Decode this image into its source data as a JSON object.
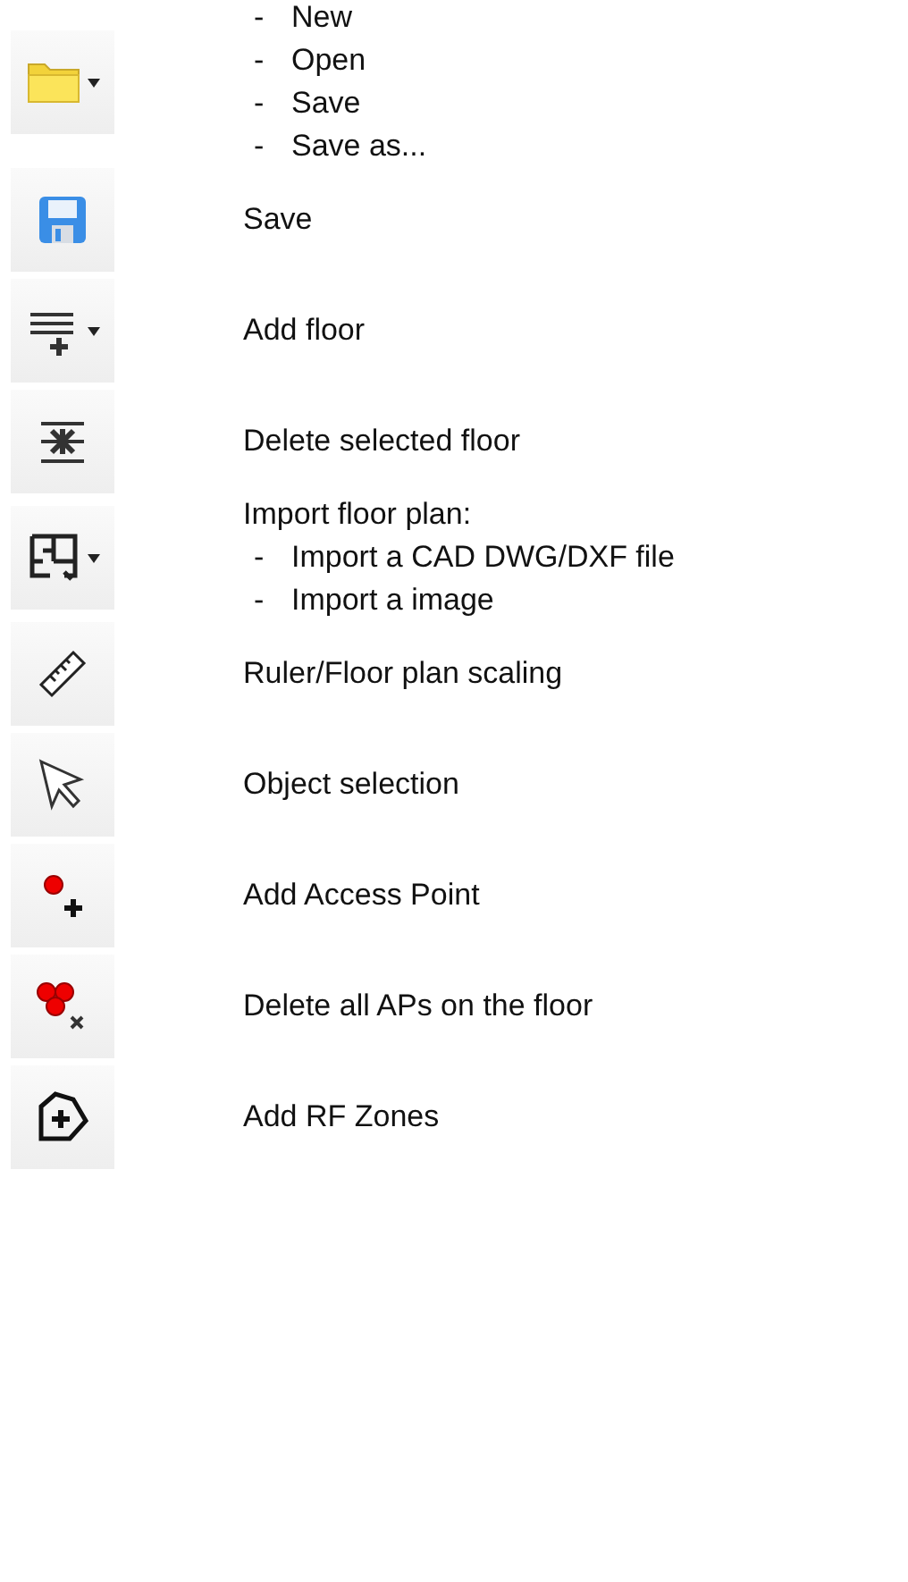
{
  "items": [
    {
      "kind": "folder",
      "dropdown": true,
      "lines": [
        {
          "bullet": "-",
          "text": "New"
        },
        {
          "bullet": "-",
          "text": "Open"
        },
        {
          "bullet": "-",
          "text": "Save"
        },
        {
          "bullet": "-",
          "text": "Save as..."
        }
      ]
    },
    {
      "kind": "floppy",
      "dropdown": false,
      "lines": [
        {
          "text": "Save"
        }
      ]
    },
    {
      "kind": "add-floor",
      "dropdown": true,
      "lines": [
        {
          "text": "Add floor"
        }
      ]
    },
    {
      "kind": "delete-floor",
      "dropdown": false,
      "lines": [
        {
          "text": "Delete selected floor"
        }
      ]
    },
    {
      "kind": "floor-plan",
      "dropdown": true,
      "lines": [
        {
          "text": "Import floor plan:"
        },
        {
          "bullet": "-",
          "text": "Import a CAD DWG/DXF file"
        },
        {
          "bullet": "-",
          "text": "Import a image"
        }
      ]
    },
    {
      "kind": "ruler",
      "dropdown": false,
      "lines": [
        {
          "text": "Ruler/Floor plan scaling"
        }
      ]
    },
    {
      "kind": "arrow",
      "dropdown": false,
      "lines": [
        {
          "text": "Object selection"
        }
      ]
    },
    {
      "kind": "add-point",
      "dropdown": false,
      "lines": [
        {
          "text": "Add Access Point"
        }
      ]
    },
    {
      "kind": "delete-points",
      "dropdown": false,
      "lines": [
        {
          "text": "Delete all APs on the floor"
        }
      ]
    },
    {
      "kind": "zone",
      "dropdown": false,
      "lines": [
        {
          "text": "Add RF Zones"
        }
      ]
    }
  ]
}
